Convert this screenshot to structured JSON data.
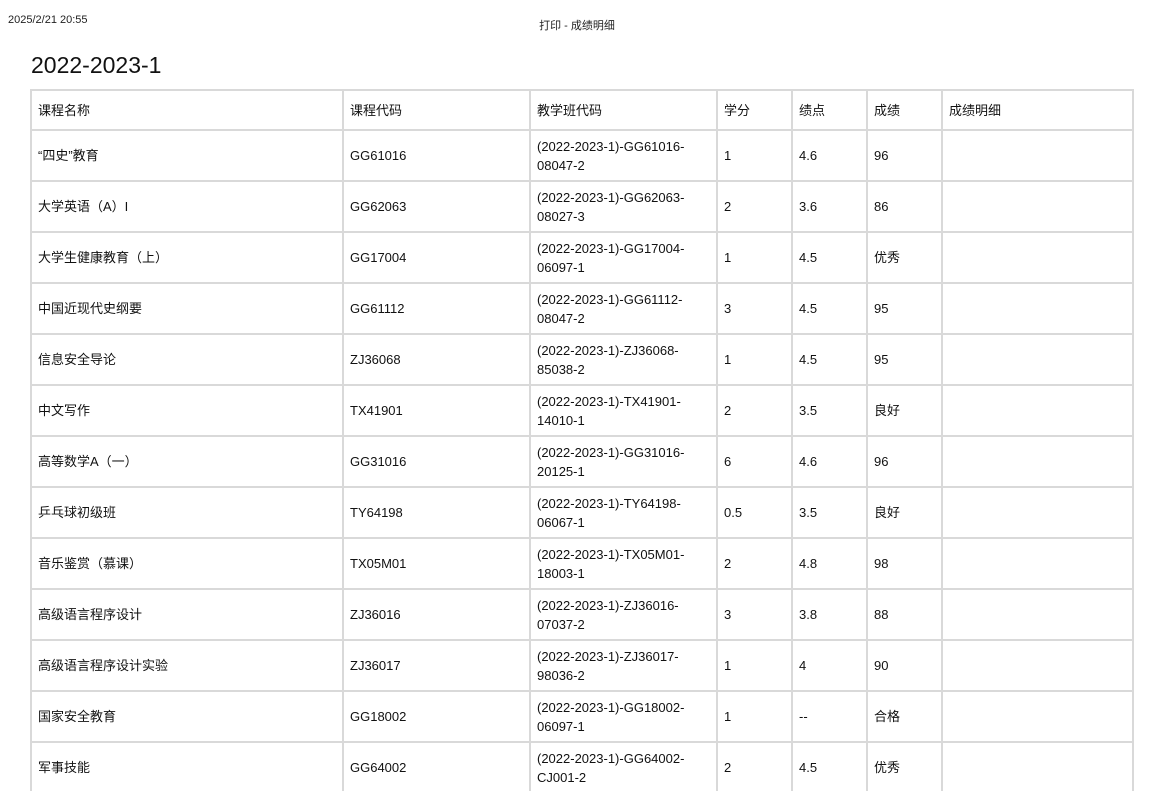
{
  "print_header": {
    "datetime": "2025/2/21 20:55",
    "title": "打印 - 成绩明细"
  },
  "term": "2022-2023-1",
  "table": {
    "headers": [
      "课程名称",
      "课程代码",
      "教学班代码",
      "学分",
      "绩点",
      "成绩",
      "成绩明细"
    ],
    "rows": [
      [
        "“四史”教育",
        "GG61016",
        "(2022-2023-1)-GG61016-08047-2",
        "1",
        "4.6",
        "96",
        ""
      ],
      [
        "大学英语（A）I",
        "GG62063",
        "(2022-2023-1)-GG62063-08027-3",
        "2",
        "3.6",
        "86",
        ""
      ],
      [
        "大学生健康教育（上）",
        "GG17004",
        "(2022-2023-1)-GG17004-06097-1",
        "1",
        "4.5",
        "优秀",
        ""
      ],
      [
        "中国近现代史纲要",
        "GG61112",
        "(2022-2023-1)-GG61112-08047-2",
        "3",
        "4.5",
        "95",
        ""
      ],
      [
        "信息安全导论",
        "ZJ36068",
        "(2022-2023-1)-ZJ36068-85038-2",
        "1",
        "4.5",
        "95",
        ""
      ],
      [
        "中文写作",
        "TX41901",
        "(2022-2023-1)-TX41901-14010-1",
        "2",
        "3.5",
        "良好",
        ""
      ],
      [
        "高等数学A（一）",
        "GG31016",
        "(2022-2023-1)-GG31016-20125-1",
        "6",
        "4.6",
        "96",
        ""
      ],
      [
        "乒乓球初级班",
        "TY64198",
        "(2022-2023-1)-TY64198-06067-1",
        "0.5",
        "3.5",
        "良好",
        ""
      ],
      [
        "音乐鉴赏（慕课）",
        "TX05M01",
        "(2022-2023-1)-TX05M01-18003-1",
        "2",
        "4.8",
        "98",
        ""
      ],
      [
        "高级语言程序设计",
        "ZJ36016",
        "(2022-2023-1)-ZJ36016-07037-2",
        "3",
        "3.8",
        "88",
        ""
      ],
      [
        "高级语言程序设计实验",
        "ZJ36017",
        "(2022-2023-1)-ZJ36017-98036-2",
        "1",
        "4",
        "90",
        ""
      ],
      [
        "国家安全教育",
        "GG18002",
        "(2022-2023-1)-GG18002-06097-1",
        "1",
        "--",
        "合格",
        ""
      ],
      [
        "军事技能",
        "GG64002",
        "(2022-2023-1)-GG64002-CJ001-2",
        "2",
        "4.5",
        "优秀",
        ""
      ]
    ]
  }
}
